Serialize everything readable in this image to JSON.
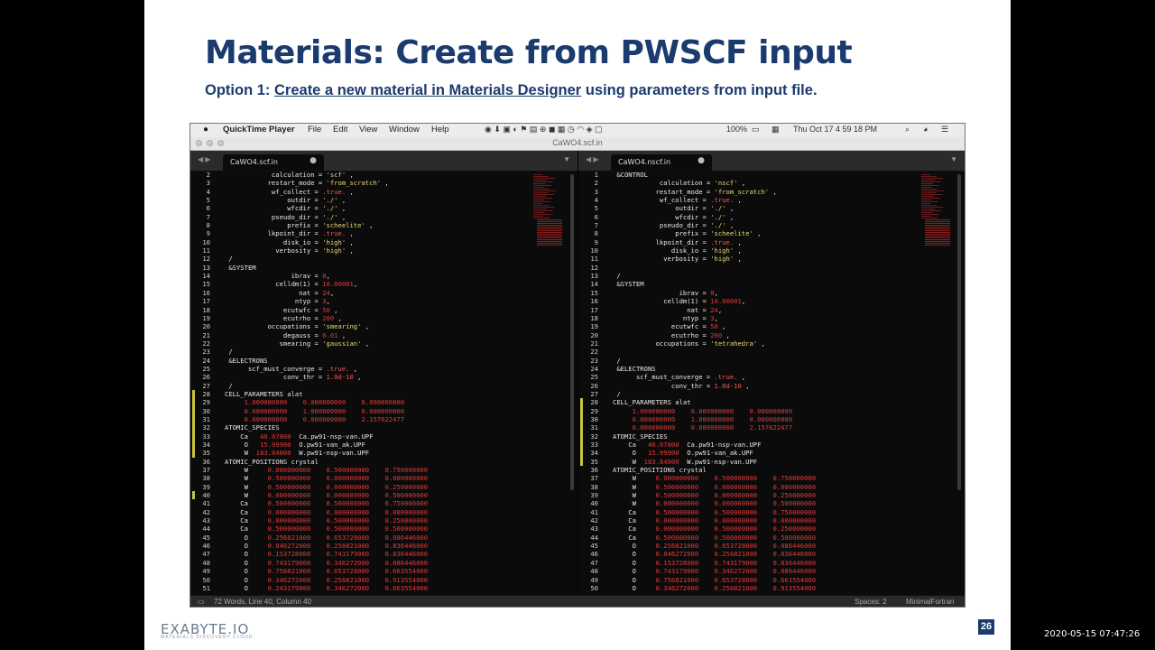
{
  "slide": {
    "title": "Materials: Create from PWSCF input",
    "subtitle_prefix": "Option 1: ",
    "subtitle_link": "Create a new material in Materials Designer",
    "subtitle_suffix": " using parameters from input file.",
    "logo": "EXABYTE.IO",
    "logo_sub": "MATERIALS DISCOVERY CLOUD",
    "page_number": "26"
  },
  "timestamp": "2020-05-15 07:47:26",
  "menubar": {
    "apple": "",
    "app": "QuickTime Player",
    "items": [
      "File",
      "Edit",
      "View",
      "Window",
      "Help"
    ],
    "battery": "100%",
    "clock": "Thu Oct 17  4 59 18 PM"
  },
  "window_title": "CaWO4.scf.in",
  "left_pane": {
    "tab": "CaWO4.scf.in",
    "lines": [
      {
        "n": "2",
        "t": "            calculation = 'scf' ,"
      },
      {
        "n": "3",
        "t": "           restart_mode = 'from_scratch' ,"
      },
      {
        "n": "4",
        "t": "            wf_collect = .true. ,"
      },
      {
        "n": "5",
        "t": "                outdir = './' ,"
      },
      {
        "n": "6",
        "t": "                wfcdir = './' ,"
      },
      {
        "n": "7",
        "t": "            pseudo_dir = './' ,"
      },
      {
        "n": "8",
        "t": "                prefix = 'scheelite' ,"
      },
      {
        "n": "9",
        "t": "           lkpoint_dir = .true. ,"
      },
      {
        "n": "10",
        "t": "               disk_io = 'high' ,"
      },
      {
        "n": "11",
        "t": "             verbosity = 'high' ,"
      },
      {
        "n": "12",
        "t": " /"
      },
      {
        "n": "13",
        "t": " &SYSTEM"
      },
      {
        "n": "14",
        "t": "                 ibrav = 0,"
      },
      {
        "n": "15",
        "t": "             celldm(1) = 10.00001,"
      },
      {
        "n": "16",
        "t": "                   nat = 24,"
      },
      {
        "n": "17",
        "t": "                  ntyp = 3,"
      },
      {
        "n": "18",
        "t": "               ecutwfc = 50 ,"
      },
      {
        "n": "19",
        "t": "               ecutrho = 200 ,"
      },
      {
        "n": "20",
        "t": "           occupations = 'smearing' ,"
      },
      {
        "n": "21",
        "t": "               degauss = 0.01 ,"
      },
      {
        "n": "22",
        "t": "              smearing = 'gaussian' ,"
      },
      {
        "n": "23",
        "t": " /"
      },
      {
        "n": "24",
        "t": " &ELECTRONS"
      },
      {
        "n": "25",
        "t": "      scf_must_converge = .true. ,"
      },
      {
        "n": "26",
        "t": "               conv_thr = 1.0d-10 ,"
      },
      {
        "n": "27",
        "t": " /"
      },
      {
        "n": "28",
        "t": "CELL_PARAMETERS alat"
      },
      {
        "n": "29",
        "t": "     1.000000000    0.000000000    0.000000000"
      },
      {
        "n": "30",
        "t": "     0.000000000    1.000000000    0.000000000"
      },
      {
        "n": "31",
        "t": "     0.000000000    0.000000000    2.157622477"
      },
      {
        "n": "32",
        "t": "ATOMIC_SPECIES"
      },
      {
        "n": "33",
        "t": "    Ca   40.07800  Ca.pw91-nsp-van.UPF"
      },
      {
        "n": "34",
        "t": "     O   15.99900  O.pw91-van_ak.UPF"
      },
      {
        "n": "35",
        "t": "     W  183.84000  W.pw91-nsp-van.UPF"
      },
      {
        "n": "36",
        "t": "ATOMIC_POSITIONS crystal"
      },
      {
        "n": "37",
        "t": "     W     0.000000000    0.500000000    0.750000000"
      },
      {
        "n": "38",
        "t": "     W     0.500000000    0.000000000    0.000000000"
      },
      {
        "n": "39",
        "t": "     W     0.500000000    0.000000000    0.250000000"
      },
      {
        "n": "40",
        "t": "     W     0.000000000    0.000000000    0.500000000"
      },
      {
        "n": "41",
        "t": "    Ca     0.500000000    0.500000000    0.750000000"
      },
      {
        "n": "42",
        "t": "    Ca     0.000000000    0.000000000    0.000000000"
      },
      {
        "n": "43",
        "t": "    Ca     0.000000000    0.500000000    0.250000000"
      },
      {
        "n": "44",
        "t": "    Ca     0.500000000    0.500000000    0.500000000"
      },
      {
        "n": "45",
        "t": "     O     0.256821000    0.653728000    0.086446000"
      },
      {
        "n": "46",
        "t": "     O     0.846272000    0.256821000    0.836446000"
      },
      {
        "n": "47",
        "t": "     O     0.153728000    0.743179000    0.836446000"
      },
      {
        "n": "48",
        "t": "     O     0.743179000    0.346272000    0.086446000"
      },
      {
        "n": "49",
        "t": "     O     0.756821000    0.653728000    0.663554000"
      },
      {
        "n": "50",
        "t": "     O     0.346272000    0.256821000    0.913554000"
      },
      {
        "n": "51",
        "t": "     O     0.243179000    0.346272000    0.663554000"
      }
    ]
  },
  "right_pane": {
    "tab": "CaWO4.nscf.in",
    "lines": [
      {
        "n": "1",
        "t": " &CONTROL"
      },
      {
        "n": "2",
        "t": "            calculation = 'nscf' ,"
      },
      {
        "n": "3",
        "t": "           restart_mode = 'from_scratch' ,"
      },
      {
        "n": "4",
        "t": "            wf_collect = .true. ,"
      },
      {
        "n": "5",
        "t": "                outdir = './' ,"
      },
      {
        "n": "6",
        "t": "                wfcdir = './' ,"
      },
      {
        "n": "7",
        "t": "            pseudo_dir = './' ,"
      },
      {
        "n": "8",
        "t": "                prefix = 'scheelite' ,"
      },
      {
        "n": "9",
        "t": "           lkpoint_dir = .true. ,"
      },
      {
        "n": "10",
        "t": "               disk_io = 'high' ,"
      },
      {
        "n": "11",
        "t": "             verbosity = 'high' ,"
      },
      {
        "n": "12",
        "t": ""
      },
      {
        "n": "13",
        "t": " /"
      },
      {
        "n": "14",
        "t": " &SYSTEM"
      },
      {
        "n": "15",
        "t": "                 ibrav = 0,"
      },
      {
        "n": "16",
        "t": "             celldm(1) = 10.00001,"
      },
      {
        "n": "17",
        "t": "                   nat = 24,"
      },
      {
        "n": "18",
        "t": "                  ntyp = 3,"
      },
      {
        "n": "19",
        "t": "               ecutwfc = 50 ,"
      },
      {
        "n": "20",
        "t": "               ecutrho = 200 ,"
      },
      {
        "n": "21",
        "t": "           occupations = 'tetrahedra' ,"
      },
      {
        "n": "22",
        "t": ""
      },
      {
        "n": "23",
        "t": " /"
      },
      {
        "n": "24",
        "t": " &ELECTRONS"
      },
      {
        "n": "25",
        "t": "      scf_must_converge = .true. ,"
      },
      {
        "n": "26",
        "t": "               conv_thr = 1.0d-10 ,"
      },
      {
        "n": "27",
        "t": " /"
      },
      {
        "n": "28",
        "t": "CELL_PARAMETERS alat"
      },
      {
        "n": "29",
        "t": "     1.000000000    0.000000000    0.000000000"
      },
      {
        "n": "30",
        "t": "     0.000000000    1.000000000    0.000000000"
      },
      {
        "n": "31",
        "t": "     0.000000000    0.000000000    2.157622477"
      },
      {
        "n": "32",
        "t": "ATOMIC_SPECIES"
      },
      {
        "n": "33",
        "t": "    Ca   40.07800  Ca.pw91-nsp-van.UPF"
      },
      {
        "n": "34",
        "t": "     O   15.99900  O.pw91-van_ak.UPF"
      },
      {
        "n": "35",
        "t": "     W  183.84000  W.pw91-nsp-van.UPF"
      },
      {
        "n": "36",
        "t": "ATOMIC_POSITIONS crystal"
      },
      {
        "n": "37",
        "t": "     W     0.000000000    0.500000000    0.750000000"
      },
      {
        "n": "38",
        "t": "     W     0.500000000    0.000000000    0.000000000"
      },
      {
        "n": "39",
        "t": "     W     0.500000000    0.000000000    0.250000000"
      },
      {
        "n": "40",
        "t": "     W     0.000000000    0.000000000    0.500000000"
      },
      {
        "n": "41",
        "t": "    Ca     0.500000000    0.500000000    0.750000000"
      },
      {
        "n": "42",
        "t": "    Ca     0.000000000    0.000000000    0.000000000"
      },
      {
        "n": "43",
        "t": "    Ca     0.000000000    0.500000000    0.250000000"
      },
      {
        "n": "44",
        "t": "    Ca     0.500000000    0.500000000    0.500000000"
      },
      {
        "n": "45",
        "t": "     O     0.256821000    0.653728000    0.086446000"
      },
      {
        "n": "46",
        "t": "     O     0.846272000    0.256821000    0.836446000"
      },
      {
        "n": "47",
        "t": "     O     0.153728000    0.743179000    0.836446000"
      },
      {
        "n": "48",
        "t": "     O     0.743179000    0.346272000    0.086446000"
      },
      {
        "n": "49",
        "t": "     O     0.756821000    0.653728000    0.663554000"
      },
      {
        "n": "50",
        "t": "     O     0.346272000    0.256821000    0.913554000"
      }
    ]
  },
  "status": {
    "left": "72 Words, Line 40, Column 40",
    "spaces": "Spaces: 2",
    "syntax": "MinimalFortran"
  },
  "colors": {
    "title": "#1b3a6e",
    "string": "#e6db74",
    "number": "#e23a3a",
    "keyword": "#f35a5a"
  }
}
